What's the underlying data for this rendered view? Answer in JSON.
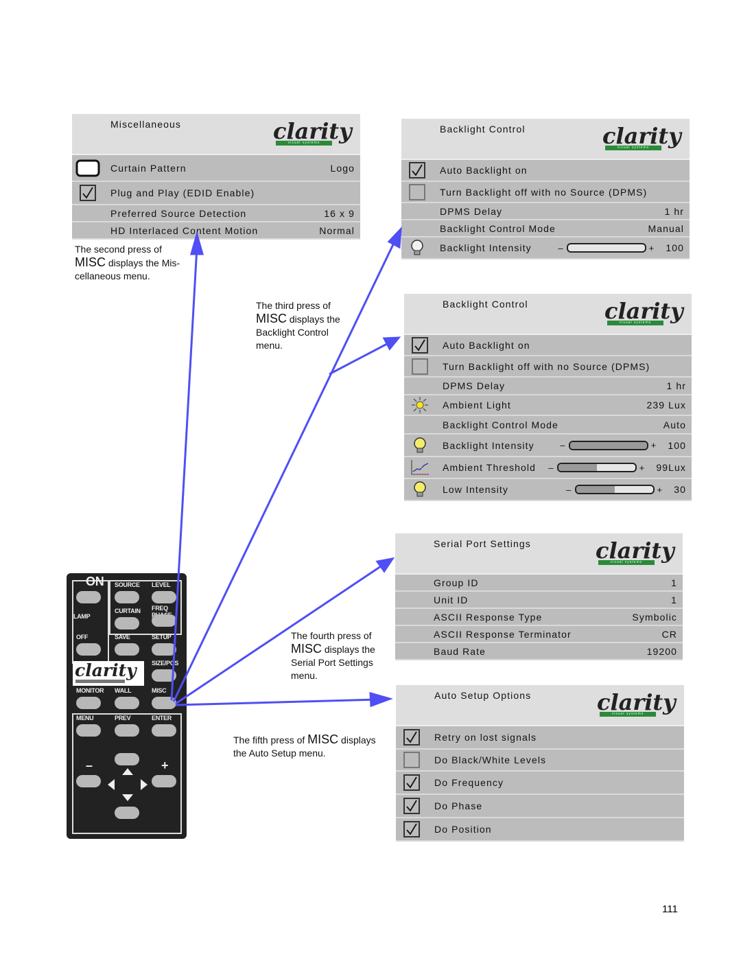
{
  "accent_color": "#4f4ff5",
  "panels": [
    {
      "id": "miscellaneous",
      "title": "Miscellaneous",
      "logo": "clarity visual systems",
      "rows": [
        {
          "icon": "monitor-icon",
          "label": "Curtain Pattern",
          "value": "Logo"
        },
        {
          "icon": "checkbox-checked",
          "label": "Plug and Play (EDID Enable)",
          "value": ""
        },
        {
          "icon": "",
          "label": "Preferred Source Detection",
          "value": "16 x 9"
        },
        {
          "icon": "",
          "label": "HD Interlaced Content Motion",
          "value": "Normal"
        }
      ]
    },
    {
      "id": "backlight-control-manual",
      "title": "Backlight Control",
      "logo": "clarity visual systems",
      "rows": [
        {
          "icon": "checkbox-checked",
          "label": "Auto Backlight on",
          "value": ""
        },
        {
          "icon": "checkbox-empty",
          "label": "Turn Backlight off with no Source (DPMS)",
          "value": ""
        },
        {
          "icon": "",
          "label": "DPMS Delay",
          "value": "1 hr"
        },
        {
          "icon": "",
          "label": "Backlight Control Mode",
          "value": "Manual"
        },
        {
          "icon": "bulb-off-icon",
          "label": "Backlight Intensity",
          "value": "100",
          "slider": {
            "minus": "–",
            "plus": "+",
            "fill": 0
          }
        }
      ]
    },
    {
      "id": "backlight-control-auto",
      "title": "Backlight Control",
      "logo": "clarity visual systems",
      "rows": [
        {
          "icon": "checkbox-checked",
          "label": "Auto Backlight on",
          "value": ""
        },
        {
          "icon": "checkbox-empty",
          "label": "Turn Backlight off with no Source (DPMS)",
          "value": ""
        },
        {
          "icon": "",
          "label": "DPMS Delay",
          "value": "1 hr"
        },
        {
          "icon": "sun-icon",
          "label": "Ambient Light",
          "value": "239 Lux"
        },
        {
          "icon": "",
          "label": "Backlight Control Mode",
          "value": "Auto"
        },
        {
          "icon": "bulb-icon",
          "label": "Backlight Intensity",
          "value": "100",
          "slider": {
            "minus": "–",
            "plus": "+",
            "fill": 1.0
          }
        },
        {
          "icon": "graph-icon",
          "label": "Ambient Threshold",
          "value": "99Lux",
          "slider": {
            "minus": "–",
            "plus": "+",
            "fill": 0.5
          }
        },
        {
          "icon": "bulb-icon",
          "label": "Low Intensity",
          "value": "30",
          "slider": {
            "minus": "–",
            "plus": "+",
            "fill": 0.5
          }
        }
      ]
    },
    {
      "id": "serial-port-settings",
      "title": "Serial Port Settings",
      "logo": "clarity visual systems",
      "rows": [
        {
          "icon": "",
          "label": "Group ID",
          "value": "1"
        },
        {
          "icon": "",
          "label": "Unit ID",
          "value": "1"
        },
        {
          "icon": "",
          "label": "ASCII Response Type",
          "value": "Symbolic"
        },
        {
          "icon": "",
          "label": "ASCII Response Terminator",
          "value": "CR"
        },
        {
          "icon": "",
          "label": "Baud Rate",
          "value": "19200"
        }
      ]
    },
    {
      "id": "auto-setup-options",
      "title": "Auto Setup Options",
      "logo": "clarity visual systems",
      "rows": [
        {
          "icon": "checkbox-checked",
          "label": "Retry on lost signals",
          "value": ""
        },
        {
          "icon": "checkbox-empty",
          "label": "Do Black/White Levels",
          "value": ""
        },
        {
          "icon": "checkbox-checked",
          "label": "Do Frequency",
          "value": ""
        },
        {
          "icon": "checkbox-checked",
          "label": "Do Phase",
          "value": ""
        },
        {
          "icon": "checkbox-checked",
          "label": "Do Position",
          "value": ""
        }
      ]
    }
  ],
  "captions": [
    {
      "pre": "The second press of",
      "big": "MISC",
      "post": " displays the Mis-",
      "last": "cellaneous menu.",
      "last2": ""
    },
    {
      "pre": "The third press of",
      "big": "MISC",
      "post": " displays the",
      "last": "Backlight Control",
      "last2": "menu."
    },
    {
      "pre": "The fourth press of",
      "big": "MISC",
      "post": " displays the",
      "last": "Serial Port Settings",
      "last2": "menu."
    },
    {
      "pre": "The fifth press of ",
      "big": "MISC",
      "post": " displays",
      "last": "the Auto Setup menu.",
      "last2": ""
    }
  ],
  "remote": {
    "logo": "clarity visual systems",
    "buttons": [
      "ON",
      "LAMP",
      "OFF",
      "SOURCE",
      "LEVEL",
      "CURTAIN",
      "FREQ PHASE",
      "SAVE",
      "SETUP",
      "SIZE/POS",
      "MONITOR",
      "WALL",
      "MISC",
      "MENU",
      "PREV",
      "ENTER",
      "–",
      "+"
    ]
  },
  "page_number": "111"
}
